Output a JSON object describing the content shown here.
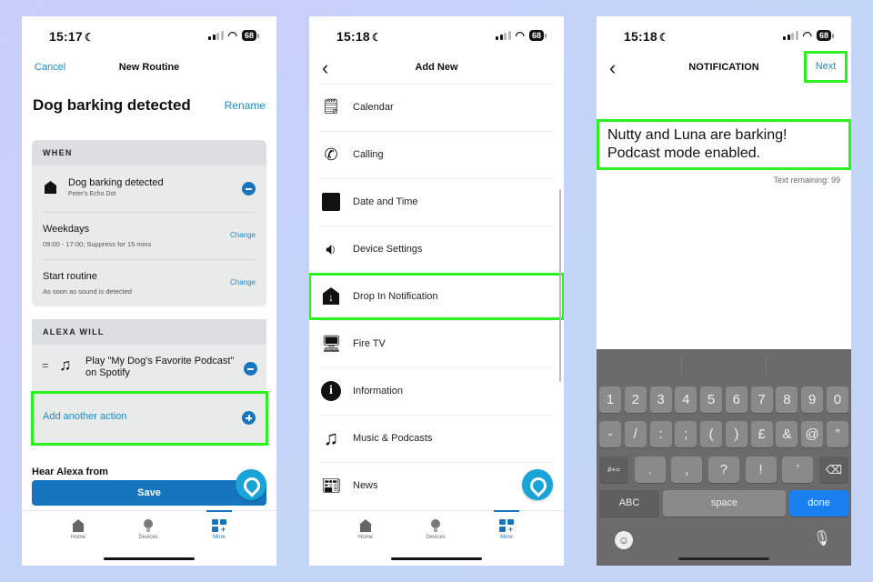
{
  "colors": {
    "accent": "#1576bf",
    "link": "#1a8bc6",
    "highlight": "#2bf11e",
    "alexa": "#1aa3d6",
    "keyboard_done": "#1a7ff0"
  },
  "screen1": {
    "status": {
      "time": "15:17",
      "battery": "68"
    },
    "nav": {
      "cancel": "Cancel",
      "title": "New Routine"
    },
    "routine_name": "Dog barking detected",
    "rename": "Rename",
    "when": {
      "header": "WHEN",
      "rows": [
        {
          "icon": "echo-dot-icon",
          "title": "Dog barking detected",
          "sub": "Peter's Echo Dot",
          "action": "remove"
        },
        {
          "title": "Weekdays",
          "sub": "09:00 - 17:00; Suppress for 15 mins",
          "action": "Change"
        },
        {
          "title": "Start routine",
          "sub": "As soon as sound is detected",
          "action": "Change"
        }
      ]
    },
    "alexa_will": {
      "header": "ALEXA WILL",
      "action_line1": "Play \"My Dog's Favorite Podcast\"",
      "action_line2": "on Spotify",
      "add": "Add another action"
    },
    "hear_alexa": "Hear Alexa from",
    "save": "Save"
  },
  "screen2": {
    "status": {
      "time": "15:18",
      "battery": "68"
    },
    "nav": {
      "title": "Add New"
    },
    "items": [
      {
        "label": "Calendar",
        "icon": "calendar-icon"
      },
      {
        "label": "Calling",
        "icon": "phone-icon"
      },
      {
        "label": "Date and Time",
        "icon": "date-time-icon"
      },
      {
        "label": "Device Settings",
        "icon": "speaker-icon"
      },
      {
        "label": "Drop In Notification",
        "icon": "drop-in-icon",
        "highlighted": true
      },
      {
        "label": "Fire TV",
        "icon": "tv-icon"
      },
      {
        "label": "Information",
        "icon": "info-icon"
      },
      {
        "label": "Music & Podcasts",
        "icon": "music-icon"
      },
      {
        "label": "News",
        "icon": "news-icon"
      }
    ]
  },
  "screen3": {
    "status": {
      "time": "15:18",
      "battery": "68"
    },
    "nav": {
      "title": "NOTIFICATION",
      "next": "Next"
    },
    "message_line1": "Nutty and Luna are barking!",
    "message_line2": "Podcast mode enabled.",
    "text_remaining": "Text remaining: 99",
    "keyboard": {
      "row1": [
        "1",
        "2",
        "3",
        "4",
        "5",
        "6",
        "7",
        "8",
        "9",
        "0"
      ],
      "row2": [
        "-",
        "/",
        ":",
        ";",
        "(",
        ")",
        "£",
        "&",
        "@",
        "”"
      ],
      "row3": [
        ".",
        ",",
        "?",
        "!",
        "’"
      ],
      "symbols": "#+=",
      "abc": "ABC",
      "space": "space",
      "done": "done"
    }
  },
  "tabbar": {
    "home": "Home",
    "devices": "Devices",
    "more": "More"
  }
}
